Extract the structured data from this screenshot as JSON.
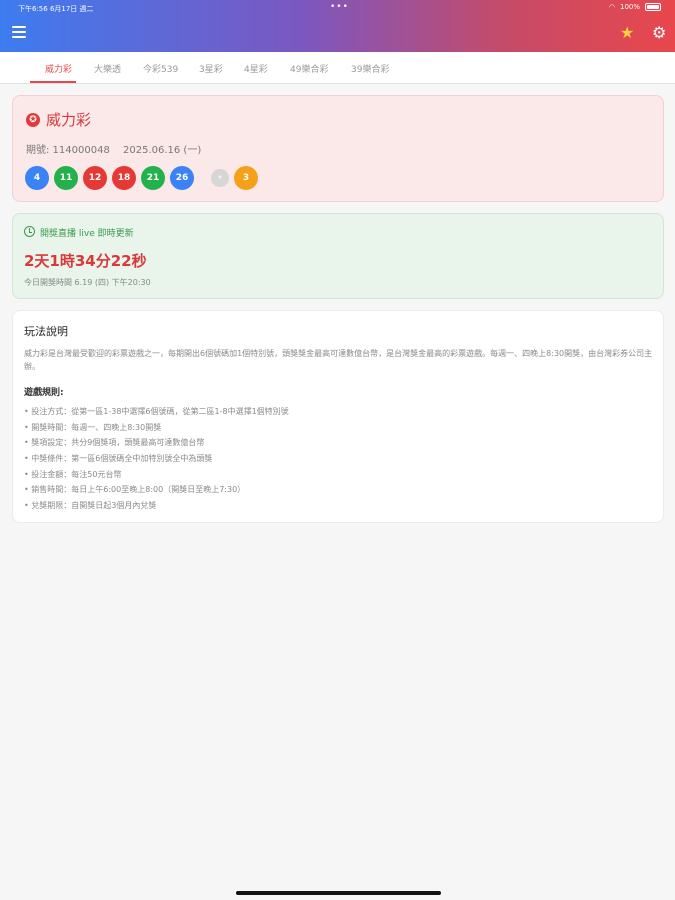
{
  "status_bar": {
    "time": "下午6:56 6月17日 週二",
    "dots": "•••",
    "battery": "100%"
  },
  "header": {
    "menu_icon": "hamburger-icon",
    "star_icon": "star-icon",
    "settings_icon": "gear-icon",
    "star_glyph": "★",
    "gear_glyph": "⚙"
  },
  "tabs": [
    "威力彩",
    "大樂透",
    "今彩539",
    "3星彩",
    "4星彩",
    "49樂合彩",
    "39樂合彩"
  ],
  "active_tab": "威力彩",
  "lottery": {
    "icon_glyph": "✪",
    "name": "威力彩",
    "period": "期號: 114000048",
    "date": "2025.06.16 (一)",
    "balls": [
      {
        "number": "4",
        "color": "#3b82f6"
      },
      {
        "number": "11",
        "color": "#22b14c"
      },
      {
        "number": "12",
        "color": "#e53935"
      },
      {
        "number": "18",
        "color": "#e53935"
      },
      {
        "number": "21",
        "color": "#22b14c"
      },
      {
        "number": "26",
        "color": "#3b82f6"
      },
      {
        "number": "+",
        "color": "#d6d6d6"
      },
      {
        "number": "3",
        "color": "#f5a01a"
      }
    ]
  },
  "live": {
    "label": "開獎直播 live 即時更新",
    "countdown": "2天1時34分22秒",
    "next_draw": "今日開獎時間 6.19 (四) 下午20:30"
  },
  "rules": {
    "title": "玩法說明",
    "description": "威力彩是台灣最受歡迎的彩票遊戲之一，每期開出6個號碼加1個特別號，頭獎獎金最高可達數億台幣，是台灣獎金最高的彩票遊戲。每週一、四晚上8:30開獎，由台灣彩券公司主辦。",
    "subtitle": "遊戲規則:",
    "items": [
      "投注方式：從第一區1-38中選擇6個號碼，從第二區1-8中選擇1個特別號",
      "開獎時間：每週一、四晚上8:30開獎",
      "獎項設定：共分9個獎項，頭獎最高可達數億台幣",
      "中獎條件：第一區6個號碼全中加特別號全中為頭獎",
      "投注金額：每注50元台幣",
      "銷售時間：每日上午6:00至晚上8:00（開獎日至晚上7:30）",
      "兌獎期限：自開獎日起3個月內兌獎"
    ]
  }
}
